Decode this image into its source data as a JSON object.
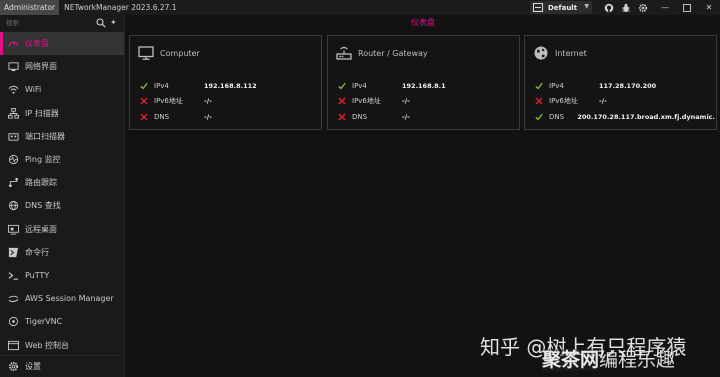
{
  "titlebar": {
    "admin_label": "Administrator",
    "app_title": "NETworkManager 2023.6.27.1",
    "profile_label": "Default"
  },
  "sidebar": {
    "search_placeholder": "搜索",
    "items": [
      {
        "label": "仪表盘",
        "icon": "dashboard-icon",
        "active": true
      },
      {
        "label": "网络界面",
        "icon": "network-interface-icon"
      },
      {
        "label": "WiFi",
        "icon": "wifi-icon"
      },
      {
        "label": "IP 扫描器",
        "icon": "ip-scanner-icon"
      },
      {
        "label": "端口扫描器",
        "icon": "port-scanner-icon"
      },
      {
        "label": "Ping 监控",
        "icon": "ping-monitor-icon"
      },
      {
        "label": "路由跟踪",
        "icon": "traceroute-icon"
      },
      {
        "label": "DNS 查找",
        "icon": "dns-lookup-icon"
      },
      {
        "label": "远程桌面",
        "icon": "remote-desktop-icon"
      },
      {
        "label": "命令行",
        "icon": "powershell-icon"
      },
      {
        "label": "PuTTY",
        "icon": "putty-icon"
      },
      {
        "label": "AWS Session Manager",
        "icon": "aws-icon"
      },
      {
        "label": "TigerVNC",
        "icon": "tigervnc-icon"
      },
      {
        "label": "Web 控制台",
        "icon": "web-console-icon"
      }
    ],
    "settings_label": "设置"
  },
  "main": {
    "tab_label": "仪表盘",
    "cards": [
      {
        "title": "Computer",
        "icon": "monitor-icon",
        "rows": [
          {
            "status": "ok",
            "label": "IPv4",
            "value": "192.168.8.112"
          },
          {
            "status": "fail",
            "label": "IPv6地址",
            "value": "-/-"
          },
          {
            "status": "fail",
            "label": "DNS",
            "value": "-/-"
          }
        ]
      },
      {
        "title": "Router / Gateway",
        "icon": "router-icon",
        "rows": [
          {
            "status": "ok",
            "label": "IPv4",
            "value": "192.168.8.1"
          },
          {
            "status": "fail",
            "label": "IPv6地址",
            "value": "-/-"
          },
          {
            "status": "fail",
            "label": "DNS",
            "value": "-/-"
          }
        ]
      },
      {
        "title": "Internet",
        "icon": "globe-icon",
        "rows": [
          {
            "status": "ok",
            "label": "IPv4",
            "value": "117.28.170.200"
          },
          {
            "status": "fail",
            "label": "IPv6地址",
            "value": "-/-"
          },
          {
            "status": "ok",
            "label": "DNS",
            "value": "200.170.28.117.broad.xm.fj.dynamic."
          }
        ]
      }
    ]
  },
  "watermark": {
    "line1": "知乎 @树上有只程序猿",
    "line2_bold": "聚茶网",
    "line2_rest": "编程乐趣"
  },
  "colors": {
    "accent": "#e0108a",
    "ok": "#8fce3a",
    "fail": "#d8202a"
  }
}
